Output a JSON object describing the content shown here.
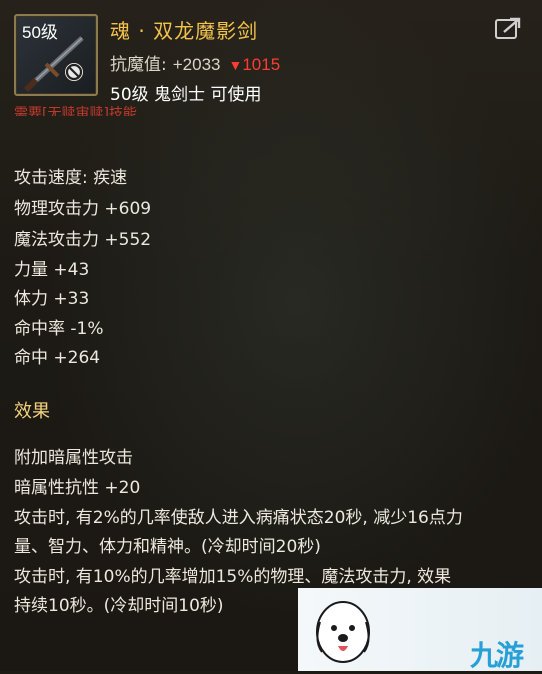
{
  "item": {
    "level_tag": "50级",
    "name": "魂 · 双龙魔影剑",
    "resist_label": "抗魔值:",
    "resist_value": "+2033",
    "resist_diff": "1015",
    "requirement": "50级 鬼剑士 可使用",
    "partial_note": "需要[无赎审赎]技能"
  },
  "stats": [
    "攻击速度: 疾速",
    "物理攻击力 +609",
    "魔法攻击力 +552",
    "力量 +43",
    "体力 +33",
    "命中率 -1%",
    "命中 +264"
  ],
  "effects": {
    "title": "效果",
    "lines": [
      "附加暗属性攻击",
      "暗属性抗性 +20",
      "攻击时, 有2%的几率使敌人进入病痛状态20秒, 减少16点力",
      "量、智力、体力和精神。(冷却时间20秒)",
      "攻击时, 有10%的几率增加15%的物理、魔法攻击力, 效果",
      "持续10秒。(冷却时间10秒)"
    ]
  },
  "watermark": {
    "text": "九游"
  },
  "colors": {
    "name": "#f2c24b",
    "diff": "#ff3b32",
    "section": "#f2d27c",
    "text": "#ece8dd"
  },
  "icons": [
    "sword-item-icon",
    "no-use-icon",
    "share-icon",
    "dog-mascot-icon"
  ]
}
